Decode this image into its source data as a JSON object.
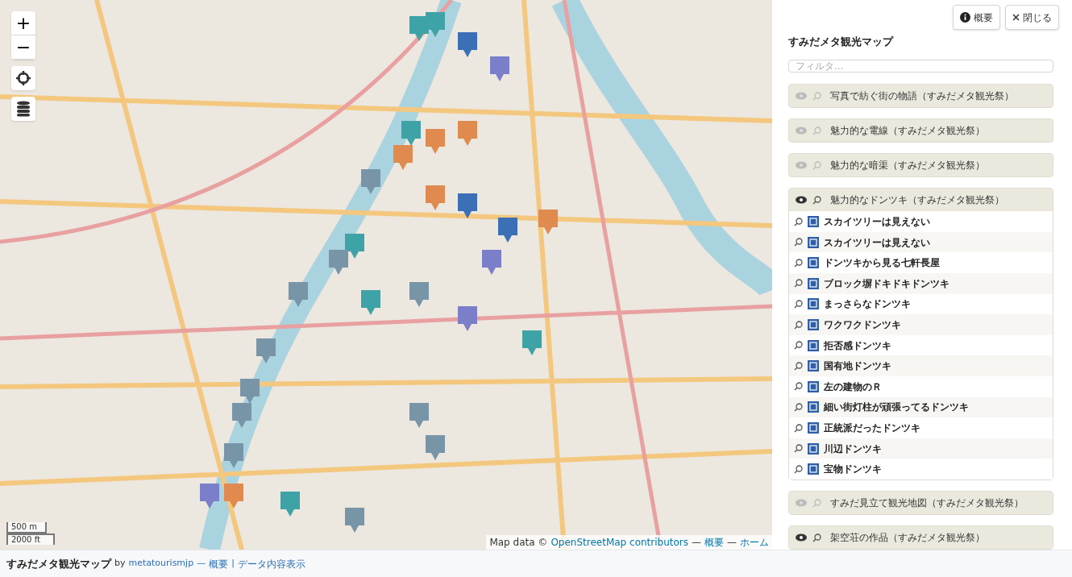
{
  "map": {
    "controls": [
      {
        "kind": "zoom_in",
        "label": "+"
      },
      {
        "kind": "zoom_out",
        "label": "−"
      },
      {
        "kind": "locate"
      },
      {
        "kind": "layers"
      }
    ],
    "scale": [
      "500 m",
      "2000 ft"
    ],
    "attribution": {
      "prefix": "Map data ©",
      "link": "OpenStreetMap contributors",
      "links": [
        {
          "sep": "—",
          "label": "概要"
        },
        {
          "sep": "—",
          "label": "ホーム"
        }
      ]
    }
  },
  "panel": {
    "buttons": [
      {
        "kind": "info",
        "label": "概要"
      },
      {
        "kind": "close",
        "label": "閉じる"
      }
    ],
    "title": "すみだメタ観光マップ",
    "filter": {
      "placeholder": "フィルタ..."
    },
    "layers": [
      {
        "name": "写真で紡ぐ街の物語（すみだメタ観光祭）",
        "visible": false
      },
      {
        "name": "魅力的な電線（すみだメタ観光祭）",
        "visible": false
      },
      {
        "name": "魅力的な暗渠（すみだメタ観光祭）",
        "visible": false
      },
      {
        "name": "魅力的なドンツキ（すみだメタ観光祭）",
        "visible": true,
        "items": [
          "スカイツリーは見えない",
          "スカイツリーは見えない",
          "ドンツキから見る七軒長屋",
          "ブロック塀ドキドキドンツキ",
          "まっさらなドンツキ",
          "ワクワクドンツキ",
          "拒否感ドンツキ",
          "国有地ドンツキ",
          "左の建物のＲ",
          "細い街灯柱が頑張ってるドンツキ",
          "正統派だったドンツキ",
          "川辺ドンツキ",
          "宝物ドンツキ"
        ]
      },
      {
        "name": "すみだ見立て観光地図（すみだメタ観光祭）",
        "visible": false
      },
      {
        "name": "架空荘の作品（すみだメタ観光祭）",
        "visible": true
      }
    ]
  },
  "footer": {
    "title": "すみだメタ観光マップ",
    "by": "by",
    "author": "metatourismjp",
    "sep1": "—",
    "about": "概要",
    "sep2": "|",
    "data": "データ内容表示"
  }
}
